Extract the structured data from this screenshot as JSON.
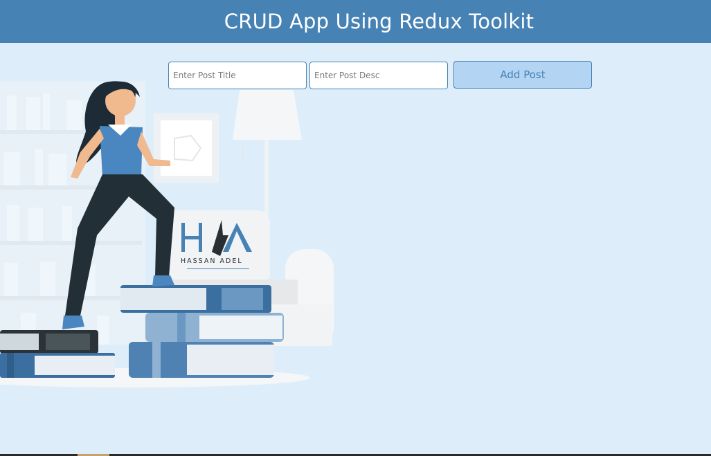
{
  "app": {
    "title": "CRUD App Using Redux Toolkit"
  },
  "form": {
    "title_placeholder": "Enter Post Title",
    "title_value": "",
    "desc_placeholder": "Enter Post Desc",
    "desc_value": "",
    "add_label": "Add Post"
  },
  "logo": {
    "mark": "H/A",
    "name": "HASSAN ADEL"
  },
  "colors": {
    "header": "#4682b4",
    "background": "#ddeefa",
    "button_bg": "#b3d4f3",
    "accent": "#4682b4"
  },
  "icons": {
    "logo": "hassan-adel-logo",
    "illustration": "woman-climbing-books-illustration"
  }
}
